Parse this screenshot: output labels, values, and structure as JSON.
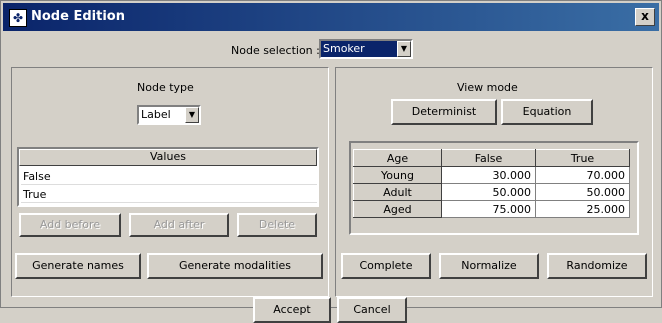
{
  "window": {
    "title": "Node Edition",
    "close": "x"
  },
  "node_selection": {
    "label": "Node selection :",
    "value": "Smoker"
  },
  "node_type": {
    "label": "Node type",
    "value": "Label"
  },
  "view_mode": {
    "label": "View mode",
    "determinist": "Determinist",
    "equation": "Equation"
  },
  "values": {
    "header": "Values",
    "items": [
      "False",
      "True"
    ]
  },
  "value_buttons": {
    "add_before": "Add before",
    "add_after": "Add after",
    "delete": "Delete"
  },
  "generate": {
    "names": "Generate names",
    "modalities": "Generate modalities"
  },
  "table": {
    "headers": [
      "Age",
      "False",
      "True"
    ],
    "rows": [
      {
        "label": "Young",
        "false": "30.000",
        "true": "70.000"
      },
      {
        "label": "Adult",
        "false": "50.000",
        "true": "50.000"
      },
      {
        "label": "Aged",
        "false": "75.000",
        "true": "25.000"
      }
    ]
  },
  "actions": {
    "complete": "Complete",
    "normalize": "Normalize",
    "randomize": "Randomize"
  },
  "footer": {
    "accept": "Accept",
    "cancel": "Cancel"
  }
}
